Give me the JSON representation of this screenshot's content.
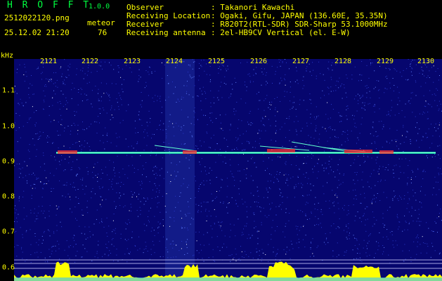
{
  "header": {
    "app_title": "H R O F F T",
    "app_version": "1.0.0",
    "file_name": "2512022120.png",
    "timestamp": "25.12.02 21:20",
    "meteor_label": "meteor",
    "meteor_count": "76",
    "info": [
      {
        "label": "Observer",
        "value": ": Takanori Kawachi"
      },
      {
        "label": "Receiving Location",
        "value": ": Ogaki, Gifu, JAPAN (136.60E, 35.35N)"
      },
      {
        "label": "Receiver",
        "value": ": R820T2(RTL-SDR) SDR-Sharp 53.1000MHz"
      },
      {
        "label": "Receiving antenna",
        "value": ": 2el-HB9CV Vertical (el. E-W)"
      }
    ]
  },
  "axes": {
    "y_unit": "kHz",
    "x_ticks": [
      "2121",
      "2122",
      "2123",
      "2124",
      "2125",
      "2126",
      "2127",
      "2128",
      "2129",
      "2130"
    ],
    "y_ticks": [
      "1.1",
      "1.0",
      "0.9",
      "0.8",
      "0.7",
      "0.6"
    ]
  },
  "colors": {
    "background": "#06066e",
    "label_text": "#ffff00",
    "title_text": "#00ff40",
    "carrier": "#00ff80",
    "echo": "#ff4040",
    "grid_line": "#ffffff"
  }
}
